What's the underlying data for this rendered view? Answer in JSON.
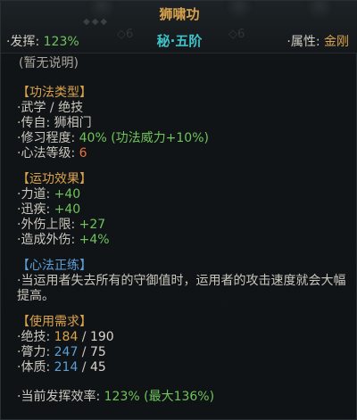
{
  "header": {
    "title": "狮啸功",
    "rank": "秘·五阶",
    "left_label": "·发挥:",
    "left_value": "123%",
    "right_label": "·属性:",
    "right_value": "金刚",
    "faint_left": "◇6",
    "faint_right": "◇6"
  },
  "note": "(暂无说明)",
  "type_section": {
    "title": "【功法类型】",
    "rows": [
      {
        "label": "·武学 / 绝技"
      },
      {
        "label": "·传自:",
        "value": "狮相门"
      },
      {
        "label": "·修习程度:",
        "value": "40%",
        "extra": "(功法威力+10%)"
      },
      {
        "label": "·心法等级:",
        "value": "6"
      }
    ]
  },
  "effect_section": {
    "title": "【运功效果】",
    "rows": [
      {
        "label": "·力道:",
        "value": "+40"
      },
      {
        "label": "·迅疾:",
        "value": "+40"
      },
      {
        "label": "·外伤上限:",
        "value": "+27"
      },
      {
        "label": "·造成外伤:",
        "value": "+4%"
      }
    ]
  },
  "xinfa_section": {
    "title": "【心法正练】",
    "desc": "·当运用者失去所有的守御值时，运用者的攻击速度就会大幅提高。"
  },
  "req_section": {
    "title": "【使用需求】",
    "rows": [
      {
        "label": "·绝技:",
        "current": "184",
        "sep": " / ",
        "required": "190"
      },
      {
        "label": "·膂力:",
        "current": "247",
        "sep": " / ",
        "required": "75"
      },
      {
        "label": "·体质:",
        "current": "214",
        "sep": " / ",
        "required": "45"
      }
    ]
  },
  "efficiency": {
    "label": "·当前发挥效率:",
    "value": "123%",
    "max": "(最大136%)"
  }
}
